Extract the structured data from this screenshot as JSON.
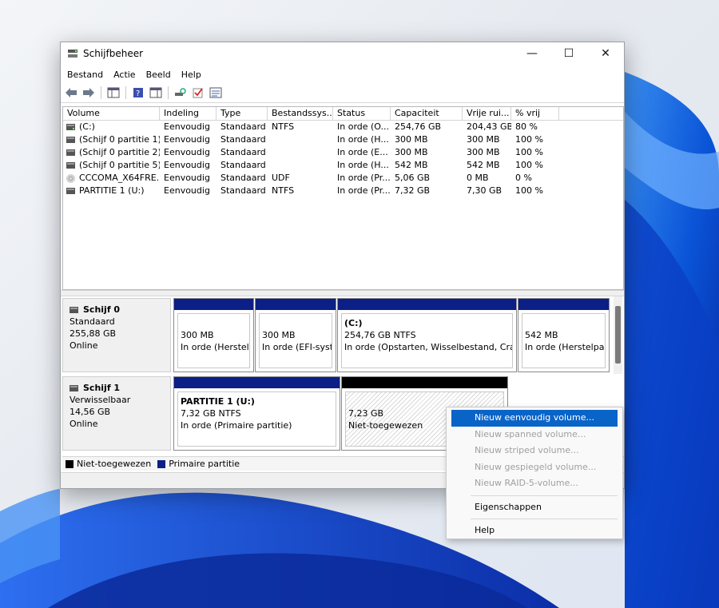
{
  "window": {
    "title": "Schijfbeheer"
  },
  "titlebar_controls": {
    "minimize": "—",
    "maximize": "☐",
    "close": "✕"
  },
  "menubar": {
    "items": [
      "Bestand",
      "Actie",
      "Beeld",
      "Help"
    ]
  },
  "toolbar": {
    "icons": [
      "back-icon",
      "forward-icon",
      "console-tree-icon",
      "help-icon",
      "show-hide-icon",
      "rescan-icon",
      "check-icon",
      "properties-icon"
    ]
  },
  "volume_list": {
    "columns": [
      "Volume",
      "Indeling",
      "Type",
      "Bestandssys...",
      "Status",
      "Capaciteit",
      "Vrije rui...",
      "% vrij"
    ],
    "rows": [
      [
        "(C:)",
        "Eenvoudig",
        "Standaard",
        "NTFS",
        "In orde (O...",
        "254,76 GB",
        "204,43 GB",
        "80 %"
      ],
      [
        "(Schijf 0 partitie 1)",
        "Eenvoudig",
        "Standaard",
        "",
        "In orde (H...",
        "300 MB",
        "300 MB",
        "100 %"
      ],
      [
        "(Schijf 0 partitie 2)",
        "Eenvoudig",
        "Standaard",
        "",
        "In orde (E...",
        "300 MB",
        "300 MB",
        "100 %"
      ],
      [
        "(Schijf 0 partitie 5)",
        "Eenvoudig",
        "Standaard",
        "",
        "In orde (H...",
        "542 MB",
        "542 MB",
        "100 %"
      ],
      [
        "CCCOMA_X64FRE...",
        "Eenvoudig",
        "Standaard",
        "UDF",
        "In orde (Pr...",
        "5,06 GB",
        "0 MB",
        "0 %"
      ],
      [
        "PARTITIE 1 (U:)",
        "Eenvoudig",
        "Standaard",
        "NTFS",
        "In orde (Pr...",
        "7,32 GB",
        "7,30 GB",
        "100 %"
      ]
    ]
  },
  "disks": [
    {
      "name": "Schijf 0",
      "type": "Standaard",
      "size": "255,88 GB",
      "state": "Online",
      "partitions": [
        {
          "title": "",
          "size": "300 MB",
          "status": "In orde (Herstelpa"
        },
        {
          "title": "",
          "size": "300 MB",
          "status": "In orde (EFI-syste"
        },
        {
          "title": "(C:)",
          "size": "254,76 GB NTFS",
          "status": "In orde (Opstarten, Wisselbestand, Crashdu"
        },
        {
          "title": "",
          "size": "542 MB",
          "status": "In orde (Herstelpart"
        }
      ]
    },
    {
      "name": "Schijf 1",
      "type": "Verwisselbaar",
      "size": "14,56 GB",
      "state": "Online",
      "partitions": [
        {
          "title": "PARTITIE 1  (U:)",
          "size": "7,32 GB NTFS",
          "status": "In orde (Primaire partitie)"
        },
        {
          "title": "",
          "size": "7,23 GB",
          "status": "Niet-toegewezen"
        }
      ]
    }
  ],
  "legend": [
    {
      "label": "Niet-toegewezen",
      "color": "#000000"
    },
    {
      "label": "Primaire partitie",
      "color": "#0b1f86"
    }
  ],
  "context_menu": {
    "items": [
      {
        "label": "Nieuw eenvoudig volume...",
        "state": "highlighted"
      },
      {
        "label": "Nieuw spanned volume...",
        "state": "disabled"
      },
      {
        "label": "Nieuw striped volume...",
        "state": "disabled"
      },
      {
        "label": "Nieuw gespiegeld volume...",
        "state": "disabled"
      },
      {
        "label": "Nieuw RAID-5-volume...",
        "state": "disabled"
      },
      {
        "label": "Eigenschappen",
        "state": "enabled"
      },
      {
        "label": "Help",
        "state": "enabled"
      }
    ]
  },
  "colors": {
    "primary_partition": "#0b1f86",
    "unallocated": "#000000",
    "menu_highlight": "#0a64c8"
  }
}
